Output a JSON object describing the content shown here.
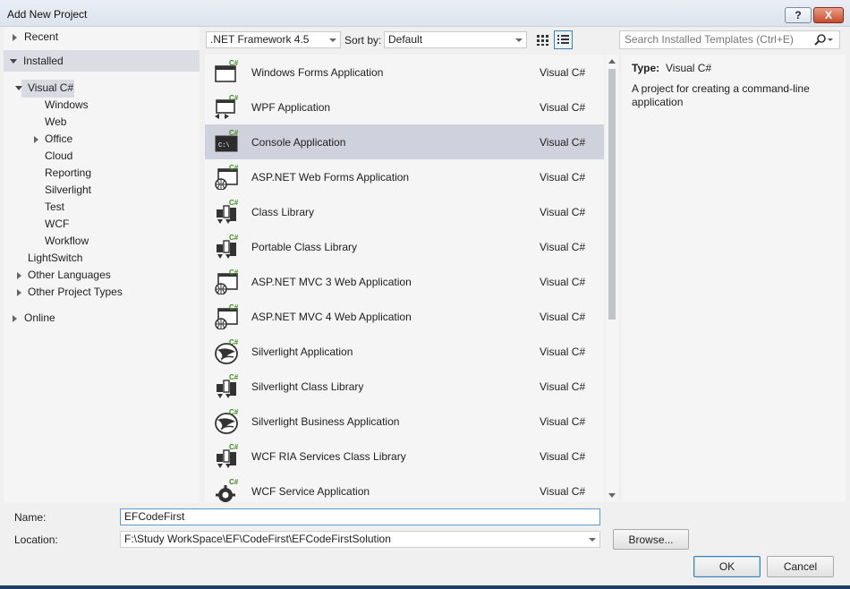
{
  "window": {
    "title": "Add New Project",
    "help_label": "?",
    "close_label": "X"
  },
  "tree": {
    "recent": "Recent",
    "installed": "Installed",
    "visual_csharp": "Visual C#",
    "children": [
      "Windows",
      "Web",
      "Office",
      "Cloud",
      "Reporting",
      "Silverlight",
      "Test",
      "WCF",
      "Workflow"
    ],
    "lightswitch": "LightSwitch",
    "other_languages": "Other Languages",
    "other_project_types": "Other Project Types",
    "online": "Online"
  },
  "toolbar": {
    "framework": ".NET Framework 4.5",
    "sort_label": "Sort by:",
    "sort_value": "Default",
    "search_placeholder": "Search Installed Templates (Ctrl+E)"
  },
  "templates": [
    {
      "name": "Windows Forms Application",
      "lang": "Visual C#",
      "icon": "windows-forms-icon"
    },
    {
      "name": "WPF Application",
      "lang": "Visual C#",
      "icon": "wpf-icon"
    },
    {
      "name": "Console Application",
      "lang": "Visual C#",
      "icon": "console-icon",
      "selected": true
    },
    {
      "name": "ASP.NET Web Forms Application",
      "lang": "Visual C#",
      "icon": "web-app-icon"
    },
    {
      "name": "Class Library",
      "lang": "Visual C#",
      "icon": "class-library-icon"
    },
    {
      "name": "Portable Class Library",
      "lang": "Visual C#",
      "icon": "class-library-icon"
    },
    {
      "name": "ASP.NET MVC 3 Web Application",
      "lang": "Visual C#",
      "icon": "web-app-icon"
    },
    {
      "name": "ASP.NET MVC 4 Web Application",
      "lang": "Visual C#",
      "icon": "web-app-icon"
    },
    {
      "name": "Silverlight Application",
      "lang": "Visual C#",
      "icon": "silverlight-icon"
    },
    {
      "name": "Silverlight Class Library",
      "lang": "Visual C#",
      "icon": "class-library-icon"
    },
    {
      "name": "Silverlight Business Application",
      "lang": "Visual C#",
      "icon": "silverlight-icon"
    },
    {
      "name": "WCF RIA Services Class Library",
      "lang": "Visual C#",
      "icon": "class-library-icon"
    },
    {
      "name": "WCF Service Application",
      "lang": "Visual C#",
      "icon": "wcf-gear-icon"
    }
  ],
  "info": {
    "type_label": "Type:",
    "type_value": "Visual C#",
    "description": "A project for creating a command-line application"
  },
  "form": {
    "name_label": "Name:",
    "name_value": "EFCodeFirst",
    "location_label": "Location:",
    "location_value": "F:\\Study WorkSpace\\EF\\CodeFirst\\EFCodeFirstSolution",
    "browse_label": "Browse...",
    "ok_label": "OK",
    "cancel_label": "Cancel"
  },
  "badge_text": "C#"
}
